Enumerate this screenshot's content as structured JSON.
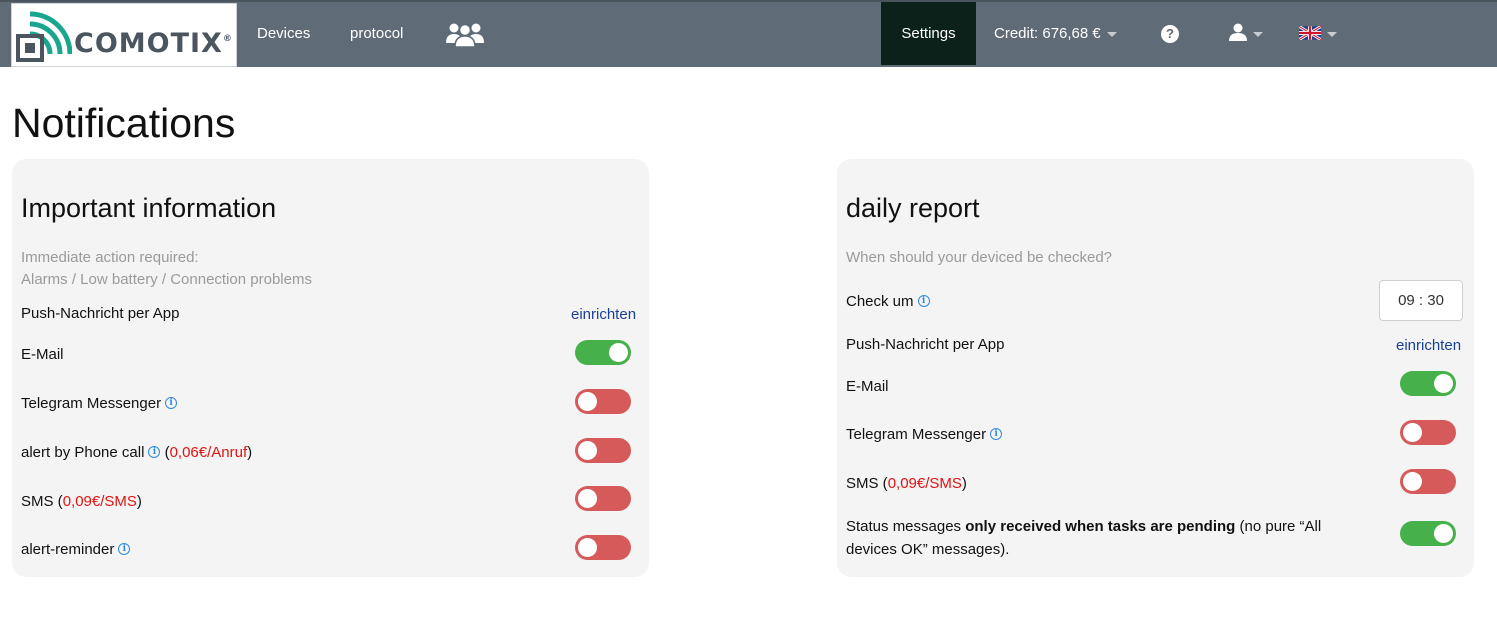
{
  "navbar": {
    "logo_text": "COMOTIX",
    "logo_mark": "®",
    "devices": "Devices",
    "protocol": "protocol",
    "users_icon": "users-icon",
    "settings": "Settings",
    "credit": "Credit: 676,68 €",
    "help_icon": "?",
    "user_icon": "user-icon",
    "language_icon": "uk-flag-icon"
  },
  "page": {
    "title": "Notifications"
  },
  "important": {
    "title": "Important information",
    "desc_line1": "Immediate action required:",
    "desc_line2": "Alarms / Low battery / Connection problems",
    "push_label": "Push-Nachricht per App",
    "push_link": "einrichten",
    "email_label": "E-Mail",
    "email_on": true,
    "telegram_label": "Telegram Messenger",
    "telegram_on": false,
    "phone_label": "alert by Phone call",
    "phone_price": "0,06€/Anruf",
    "phone_on": false,
    "sms_label": "SMS",
    "sms_price": "0,09€/SMS",
    "sms_on": false,
    "reminder_label": "alert-reminder",
    "reminder_on": false
  },
  "daily": {
    "title": "daily report",
    "desc": "When should your deviced be checked?",
    "check_label": "Check um",
    "check_time": "09 : 30",
    "push_label": "Push-Nachricht per App",
    "push_link": "einrichten",
    "email_label": "E-Mail",
    "email_on": true,
    "telegram_label": "Telegram Messenger",
    "telegram_on": false,
    "sms_label": "SMS",
    "sms_price": "0,09€/SMS",
    "sms_on": false,
    "status_prefix": "Status messages ",
    "status_bold": "only received when tasks are pending",
    "status_suffix": " (no pure “All devices OK” messages).",
    "status_on": true
  },
  "colors": {
    "navbar": "#5f6b76",
    "nav_active": "#0c2119",
    "toggle_on": "#46b04a",
    "toggle_off": "#d65a5a",
    "price": "#e31313",
    "link": "#1a3f9a"
  }
}
